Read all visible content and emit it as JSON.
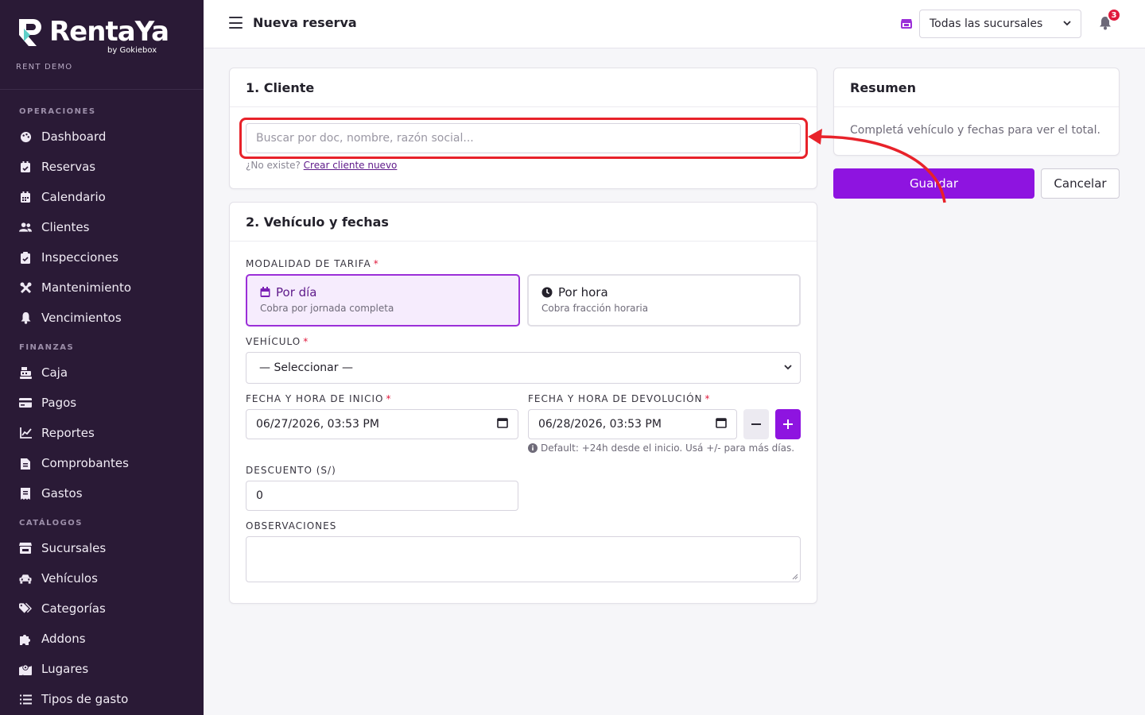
{
  "brand": {
    "name": "RentaYa",
    "by": "by Gokiebox",
    "tenant": "RENT DEMO"
  },
  "sidebar": {
    "sections": [
      {
        "title": "OPERACIONES",
        "items": [
          {
            "label": "Dashboard",
            "icon": "palette-icon"
          },
          {
            "label": "Reservas",
            "icon": "calendar-check-icon"
          },
          {
            "label": "Calendario",
            "icon": "calendar-icon"
          },
          {
            "label": "Clientes",
            "icon": "users-icon"
          },
          {
            "label": "Inspecciones",
            "icon": "clipboard-check-icon"
          },
          {
            "label": "Mantenimiento",
            "icon": "tools-icon"
          },
          {
            "label": "Vencimientos",
            "icon": "bell-icon"
          }
        ]
      },
      {
        "title": "FINANZAS",
        "items": [
          {
            "label": "Caja",
            "icon": "cash-register-icon"
          },
          {
            "label": "Pagos",
            "icon": "credit-card-icon"
          },
          {
            "label": "Reportes",
            "icon": "chart-line-icon"
          },
          {
            "label": "Comprobantes",
            "icon": "file-invoice-icon"
          },
          {
            "label": "Gastos",
            "icon": "receipt-icon"
          }
        ]
      },
      {
        "title": "CATÁLOGOS",
        "items": [
          {
            "label": "Sucursales",
            "icon": "store-icon"
          },
          {
            "label": "Vehículos",
            "icon": "car-icon"
          },
          {
            "label": "Categorías",
            "icon": "tags-icon"
          },
          {
            "label": "Addons",
            "icon": "puzzle-icon"
          },
          {
            "label": "Lugares",
            "icon": "map-location-icon"
          },
          {
            "label": "Tipos de gasto",
            "icon": "list-icon"
          }
        ]
      }
    ]
  },
  "topbar": {
    "title": "Nueva reserva",
    "branch_select": "Todas las sucursales",
    "notification_count": "3"
  },
  "cliente": {
    "header": "1. Cliente",
    "search_placeholder": "Buscar por doc, nombre, razón social...",
    "not_exists": "¿No existe?",
    "create_link": "Crear cliente nuevo"
  },
  "vehiculo": {
    "header": "2. Vehículo y fechas",
    "tariff_label": "MODALIDAD DE TARIFA",
    "tariff_day_title": "Por día",
    "tariff_day_sub": "Cobra por jornada completa",
    "tariff_hour_title": "Por hora",
    "tariff_hour_sub": "Cobra fracción horaria",
    "vehicle_label": "VEHÍCULO",
    "vehicle_select": "— Seleccionar —",
    "start_label": "FECHA Y HORA DE INICIO",
    "start_value": "06/27/2026, 03:53 PM",
    "end_label": "FECHA Y HORA DE DEVOLUCIÓN",
    "end_value": "06/28/2026, 03:53 PM",
    "hint": "Default: +24h desde el inicio. Usá +/- para más días.",
    "discount_label": "DESCUENTO (S/)",
    "discount_value": "0",
    "notes_label": "OBSERVACIONES",
    "notes_value": ""
  },
  "resumen": {
    "header": "Resumen",
    "body": "Completá vehículo y fechas para ver el total."
  },
  "actions": {
    "save": "Guardar",
    "cancel": "Cancelar"
  },
  "colors": {
    "sidebar_bg": "#2a1a36",
    "accent": "#8e14e0",
    "annotation": "#e8222a",
    "badge": "#e0193c"
  }
}
